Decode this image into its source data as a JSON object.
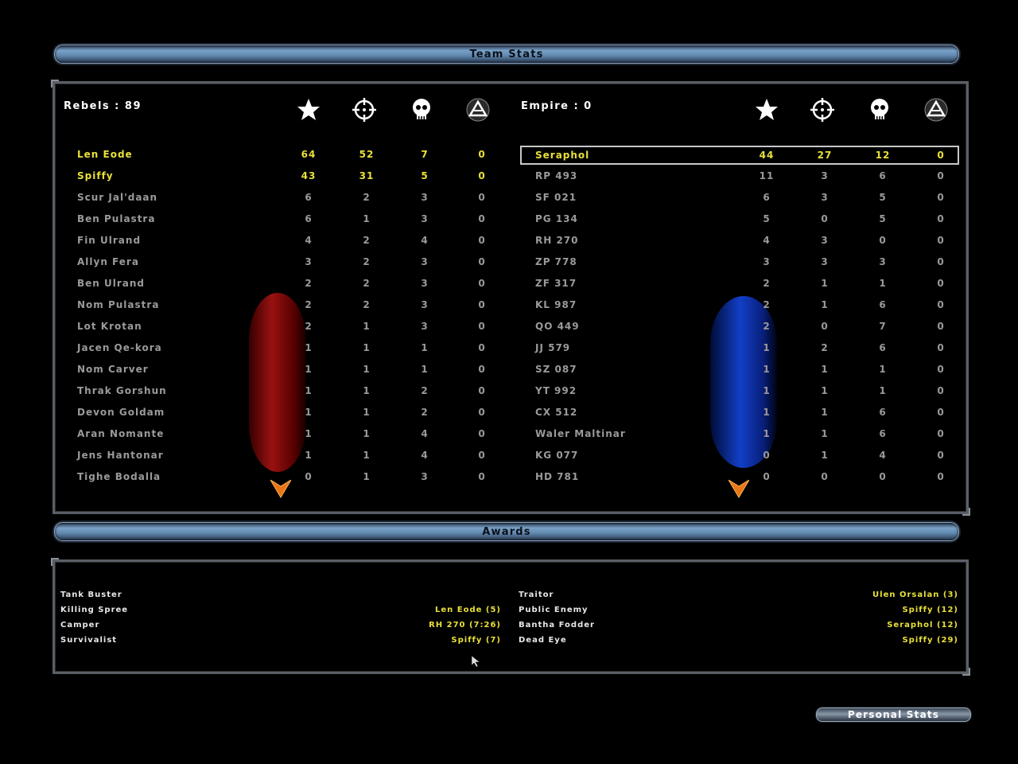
{
  "team_stats_title": "Team Stats",
  "awards_title": "Awards",
  "personal_stats_label": "Personal Stats",
  "icons": [
    "star-icon",
    "crosshair-icon",
    "skull-icon",
    "rebel-symbol-icon"
  ],
  "colors": {
    "highlight": "#e8e03a",
    "normal": "#9a9a9a",
    "rebel_glow": "#b41414",
    "empire_glow": "#1446dc"
  },
  "rebels": {
    "header": "Rebels : 89",
    "players": [
      {
        "name": "Len Eode",
        "points": "64",
        "kills": "52",
        "deaths": "7",
        "other": "0",
        "highlight": true
      },
      {
        "name": "Spiffy",
        "points": "43",
        "kills": "31",
        "deaths": "5",
        "other": "0",
        "highlight": true
      },
      {
        "name": "Scur Jal'daan",
        "points": "6",
        "kills": "2",
        "deaths": "3",
        "other": "0"
      },
      {
        "name": "Ben Pulastra",
        "points": "6",
        "kills": "1",
        "deaths": "3",
        "other": "0"
      },
      {
        "name": "Fin Ulrand",
        "points": "4",
        "kills": "2",
        "deaths": "4",
        "other": "0"
      },
      {
        "name": "Allyn Fera",
        "points": "3",
        "kills": "2",
        "deaths": "3",
        "other": "0"
      },
      {
        "name": "Ben Ulrand",
        "points": "2",
        "kills": "2",
        "deaths": "3",
        "other": "0"
      },
      {
        "name": "Nom Pulastra",
        "points": "2",
        "kills": "2",
        "deaths": "3",
        "other": "0"
      },
      {
        "name": "Lot Krotan",
        "points": "2",
        "kills": "1",
        "deaths": "3",
        "other": "0"
      },
      {
        "name": "Jacen Qe-kora",
        "points": "1",
        "kills": "1",
        "deaths": "1",
        "other": "0"
      },
      {
        "name": "Nom Carver",
        "points": "1",
        "kills": "1",
        "deaths": "1",
        "other": "0"
      },
      {
        "name": "Thrak Gorshun",
        "points": "1",
        "kills": "1",
        "deaths": "2",
        "other": "0"
      },
      {
        "name": "Devon Goldam",
        "points": "1",
        "kills": "1",
        "deaths": "2",
        "other": "0"
      },
      {
        "name": "Aran Nomante",
        "points": "1",
        "kills": "1",
        "deaths": "4",
        "other": "0"
      },
      {
        "name": "Jens Hantonar",
        "points": "1",
        "kills": "1",
        "deaths": "4",
        "other": "0"
      },
      {
        "name": "Tighe Bodalla",
        "points": "0",
        "kills": "1",
        "deaths": "3",
        "other": "0"
      }
    ]
  },
  "empire": {
    "header": "Empire : 0",
    "players": [
      {
        "name": "Seraphol",
        "points": "44",
        "kills": "27",
        "deaths": "12",
        "other": "0",
        "highlight": true,
        "selected": true
      },
      {
        "name": "RP 493",
        "points": "11",
        "kills": "3",
        "deaths": "6",
        "other": "0"
      },
      {
        "name": "SF 021",
        "points": "6",
        "kills": "3",
        "deaths": "5",
        "other": "0"
      },
      {
        "name": "PG 134",
        "points": "5",
        "kills": "0",
        "deaths": "5",
        "other": "0"
      },
      {
        "name": "RH 270",
        "points": "4",
        "kills": "3",
        "deaths": "0",
        "other": "0"
      },
      {
        "name": "ZP 778",
        "points": "3",
        "kills": "3",
        "deaths": "3",
        "other": "0"
      },
      {
        "name": "ZF 317",
        "points": "2",
        "kills": "1",
        "deaths": "1",
        "other": "0"
      },
      {
        "name": "KL 987",
        "points": "2",
        "kills": "1",
        "deaths": "6",
        "other": "0"
      },
      {
        "name": "QO 449",
        "points": "2",
        "kills": "0",
        "deaths": "7",
        "other": "0"
      },
      {
        "name": "JJ 579",
        "points": "1",
        "kills": "2",
        "deaths": "6",
        "other": "0"
      },
      {
        "name": "SZ 087",
        "points": "1",
        "kills": "1",
        "deaths": "1",
        "other": "0"
      },
      {
        "name": "YT 992",
        "points": "1",
        "kills": "1",
        "deaths": "1",
        "other": "0"
      },
      {
        "name": "CX 512",
        "points": "1",
        "kills": "1",
        "deaths": "6",
        "other": "0"
      },
      {
        "name": "Waler Maltinar",
        "points": "1",
        "kills": "1",
        "deaths": "6",
        "other": "0"
      },
      {
        "name": "KG 077",
        "points": "0",
        "kills": "1",
        "deaths": "4",
        "other": "0"
      },
      {
        "name": "HD 781",
        "points": "0",
        "kills": "0",
        "deaths": "0",
        "other": "0"
      }
    ]
  },
  "awards": {
    "left": [
      {
        "label": "Tank Buster",
        "winner": ""
      },
      {
        "label": "Killing Spree",
        "winner": "Len Eode (5)"
      },
      {
        "label": "Camper",
        "winner": "RH 270 (7:26)"
      },
      {
        "label": "Survivalist",
        "winner": "Spiffy (7)"
      }
    ],
    "right": [
      {
        "label": "Traitor",
        "winner": "Ulen Orsalan (3)"
      },
      {
        "label": "Public Enemy",
        "winner": "Spiffy (12)"
      },
      {
        "label": "Bantha Fodder",
        "winner": "Seraphol (12)"
      },
      {
        "label": "Dead Eye",
        "winner": "Spiffy (29)"
      }
    ]
  }
}
